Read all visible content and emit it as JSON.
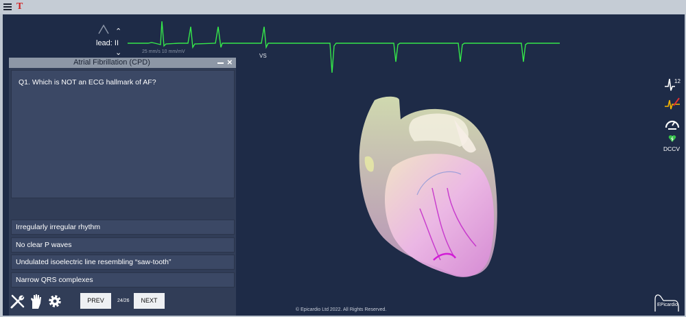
{
  "topbar": {
    "menu_icon": "menu-icon",
    "t_label": "T"
  },
  "ecg": {
    "lead_label": "lead: II",
    "scale_text": "25 mm/s   10 mm/mV",
    "vs_label": "VS",
    "trace_color": "#35e84a"
  },
  "panel": {
    "title": "Atrial Fibrillation (CPD)",
    "question": "Q1. Which is NOT an ECG hallmark of AF?",
    "answers": [
      "Irregularly irregular rhythm",
      "No clear P waves",
      "Undulated isoelectric line resembling “saw-tooth”",
      "Narrow QRS complexes"
    ],
    "prev_label": "PREV",
    "page_counter": "24/26",
    "next_label": "NEXT"
  },
  "right_tools": {
    "dccv_label": "DCCV",
    "twelve_lead": "12"
  },
  "footer": {
    "copyright": "© Epicardio Ltd 2022. All Rights Reserved.",
    "logo_text": "EPicardio"
  }
}
